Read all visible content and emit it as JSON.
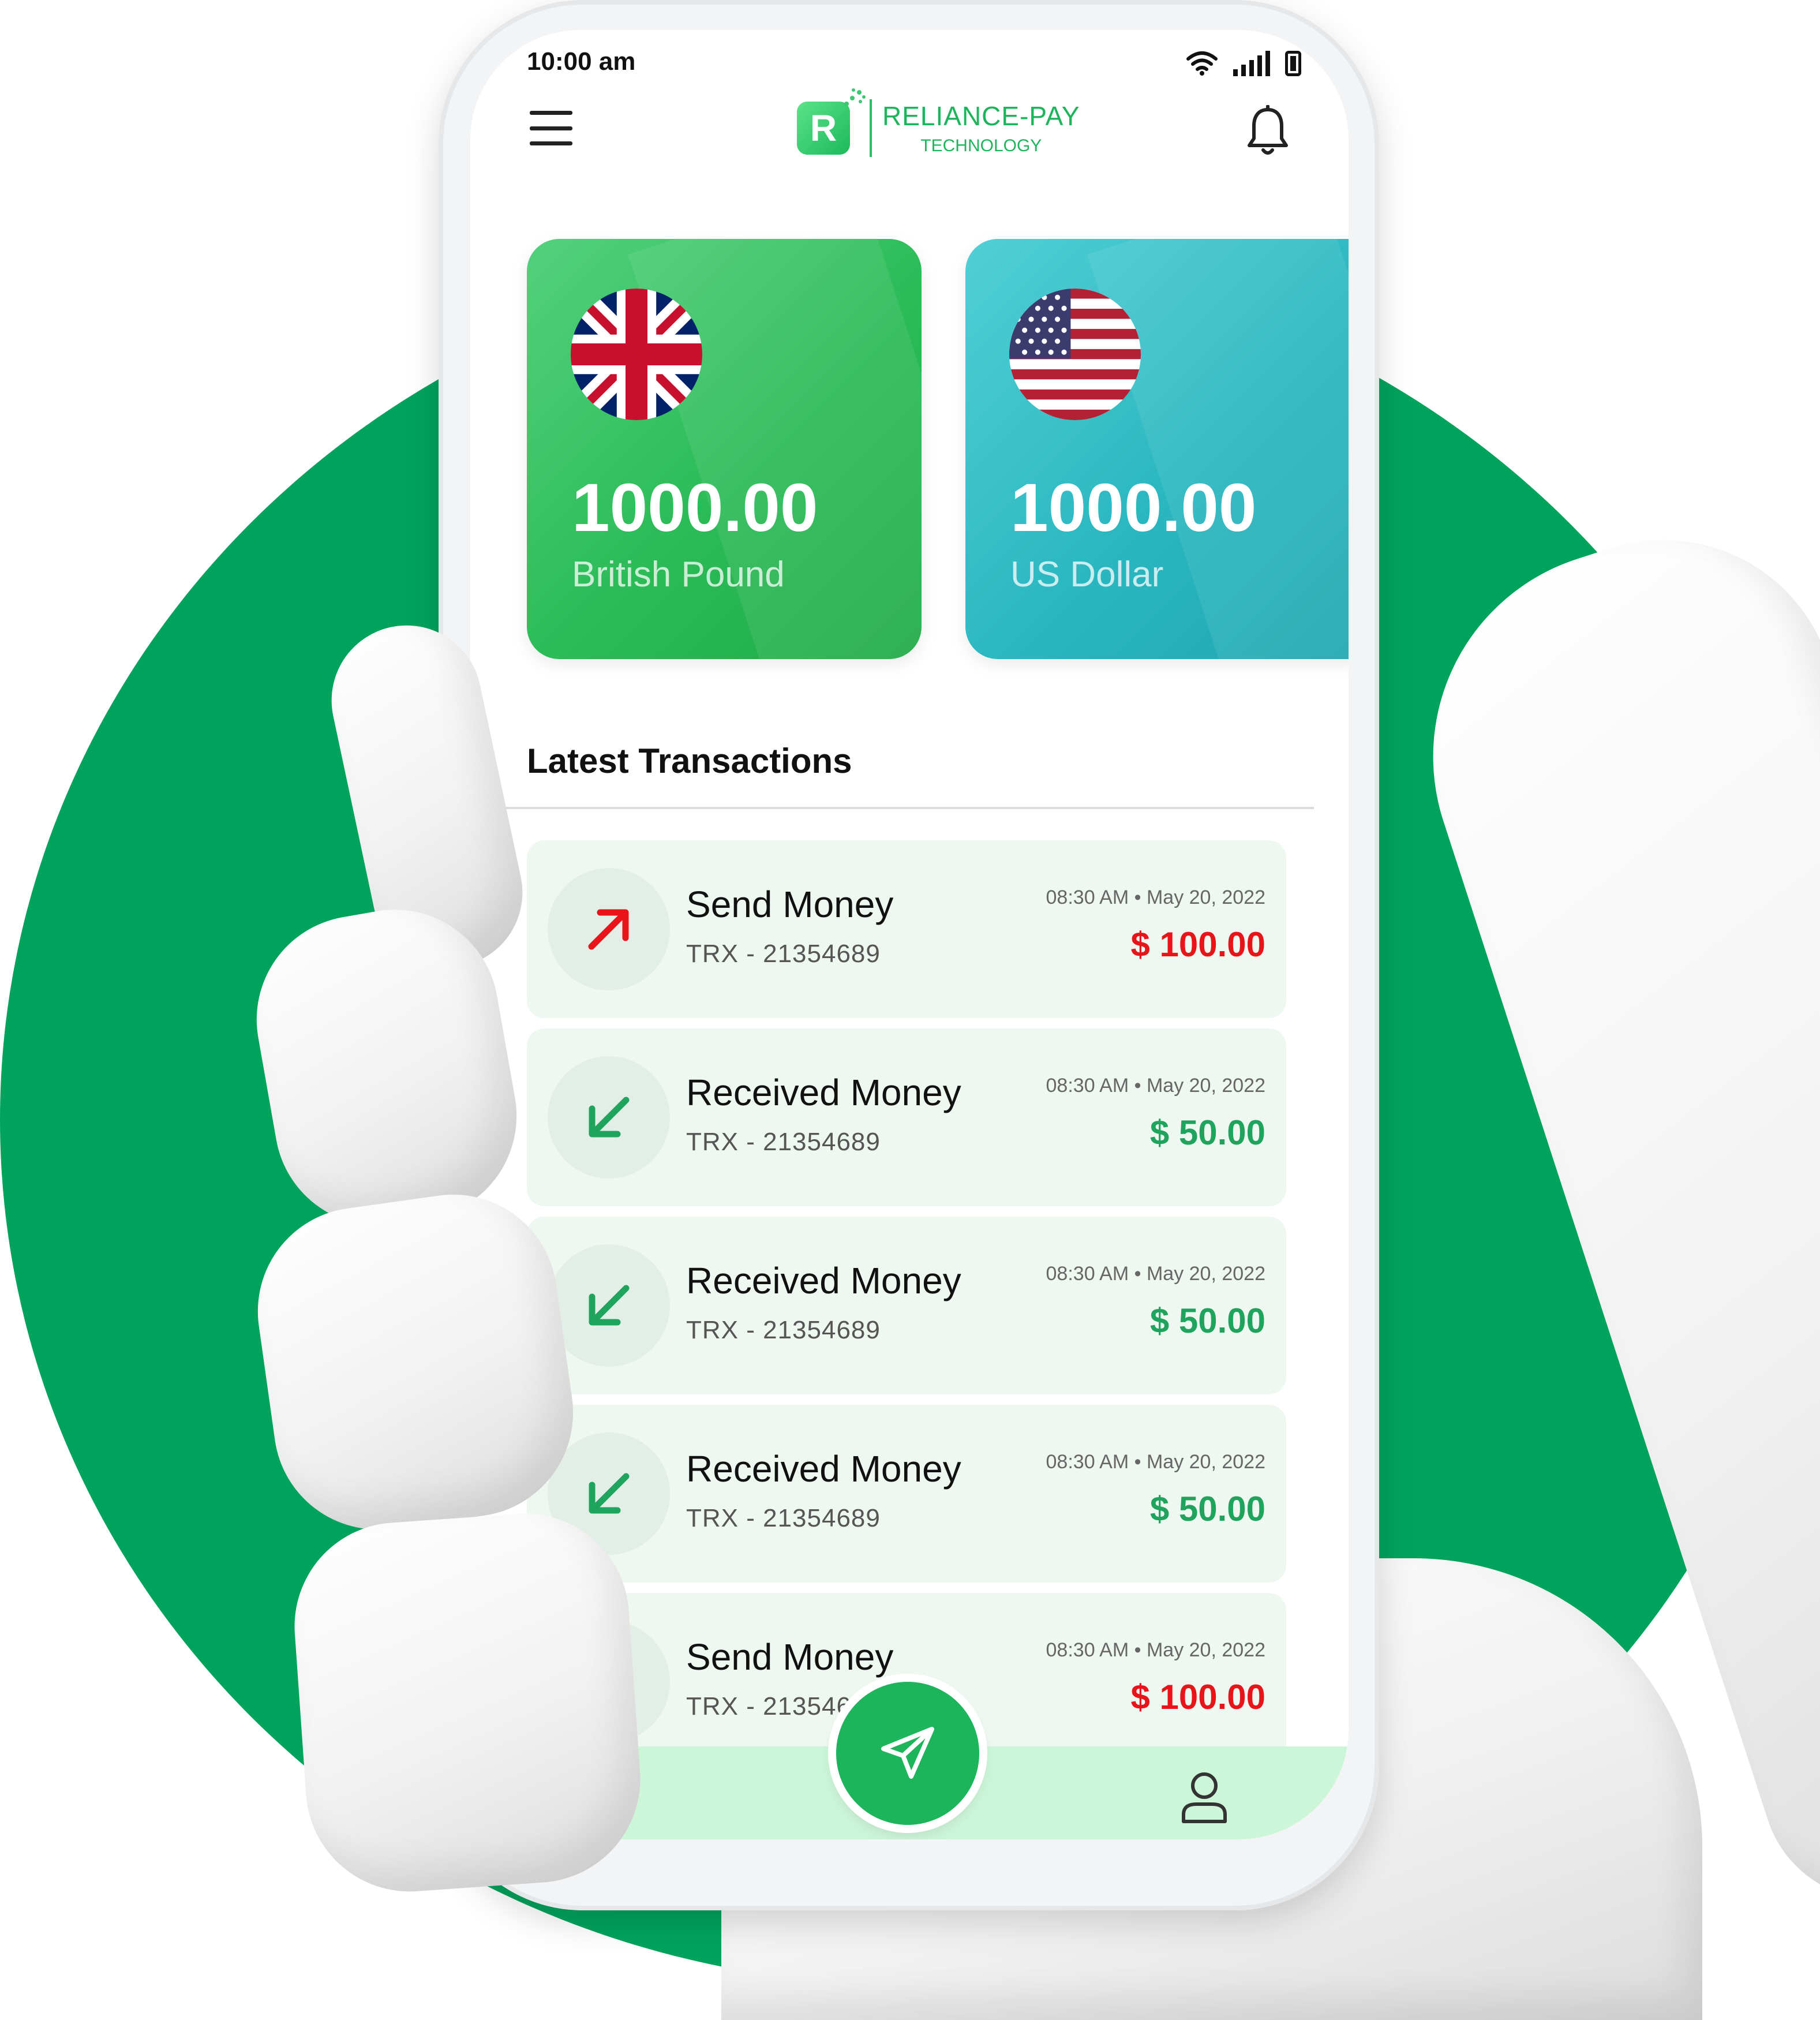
{
  "status_bar": {
    "time": "10:00 am"
  },
  "header": {
    "logo_letter": "R",
    "logo_name": "RELIANCE-PAY",
    "logo_sub": "TECHNOLOGY"
  },
  "wallets": [
    {
      "amount": "1000.00",
      "currency": "British Pound",
      "flag": "uk-flag"
    },
    {
      "amount": "1000.00",
      "currency": "US Dollar",
      "flag": "us-flag"
    }
  ],
  "transactions_title": "Latest Transactions",
  "transactions": [
    {
      "title": "Send Money",
      "id": "TRX - 21354689",
      "time": "08:30 AM",
      "date": "May 20, 2022",
      "amount": "$ 100.00",
      "type": "send"
    },
    {
      "title": "Received Money",
      "id": "TRX - 21354689",
      "time": "08:30 AM",
      "date": "May 20, 2022",
      "amount": "$ 50.00",
      "type": "received"
    },
    {
      "title": "Received Money",
      "id": "TRX - 21354689",
      "time": "08:30 AM",
      "date": "May 20, 2022",
      "amount": "$ 50.00",
      "type": "received"
    },
    {
      "title": "Received Money",
      "id": "TRX - 21354689",
      "time": "08:30 AM",
      "date": "May 20, 2022",
      "amount": "$ 50.00",
      "type": "received"
    },
    {
      "title": "Send Money",
      "id": "TRX - 21354689",
      "time": "08:30 AM",
      "date": "May 20, 2022",
      "amount": "$ 100.00",
      "type": "send"
    }
  ],
  "colors": {
    "brand_green": "#1db55c",
    "circle_green": "#00a35c",
    "send_red": "#e8141a",
    "receive_green": "#1ea45c",
    "usd_card": "#2ab7c0"
  },
  "icons": [
    "menu-icon",
    "bell-icon",
    "wifi-icon",
    "signal-icon",
    "battery-icon",
    "arrow-up-right-icon",
    "arrow-down-left-icon",
    "send-icon",
    "profile-icon"
  ]
}
